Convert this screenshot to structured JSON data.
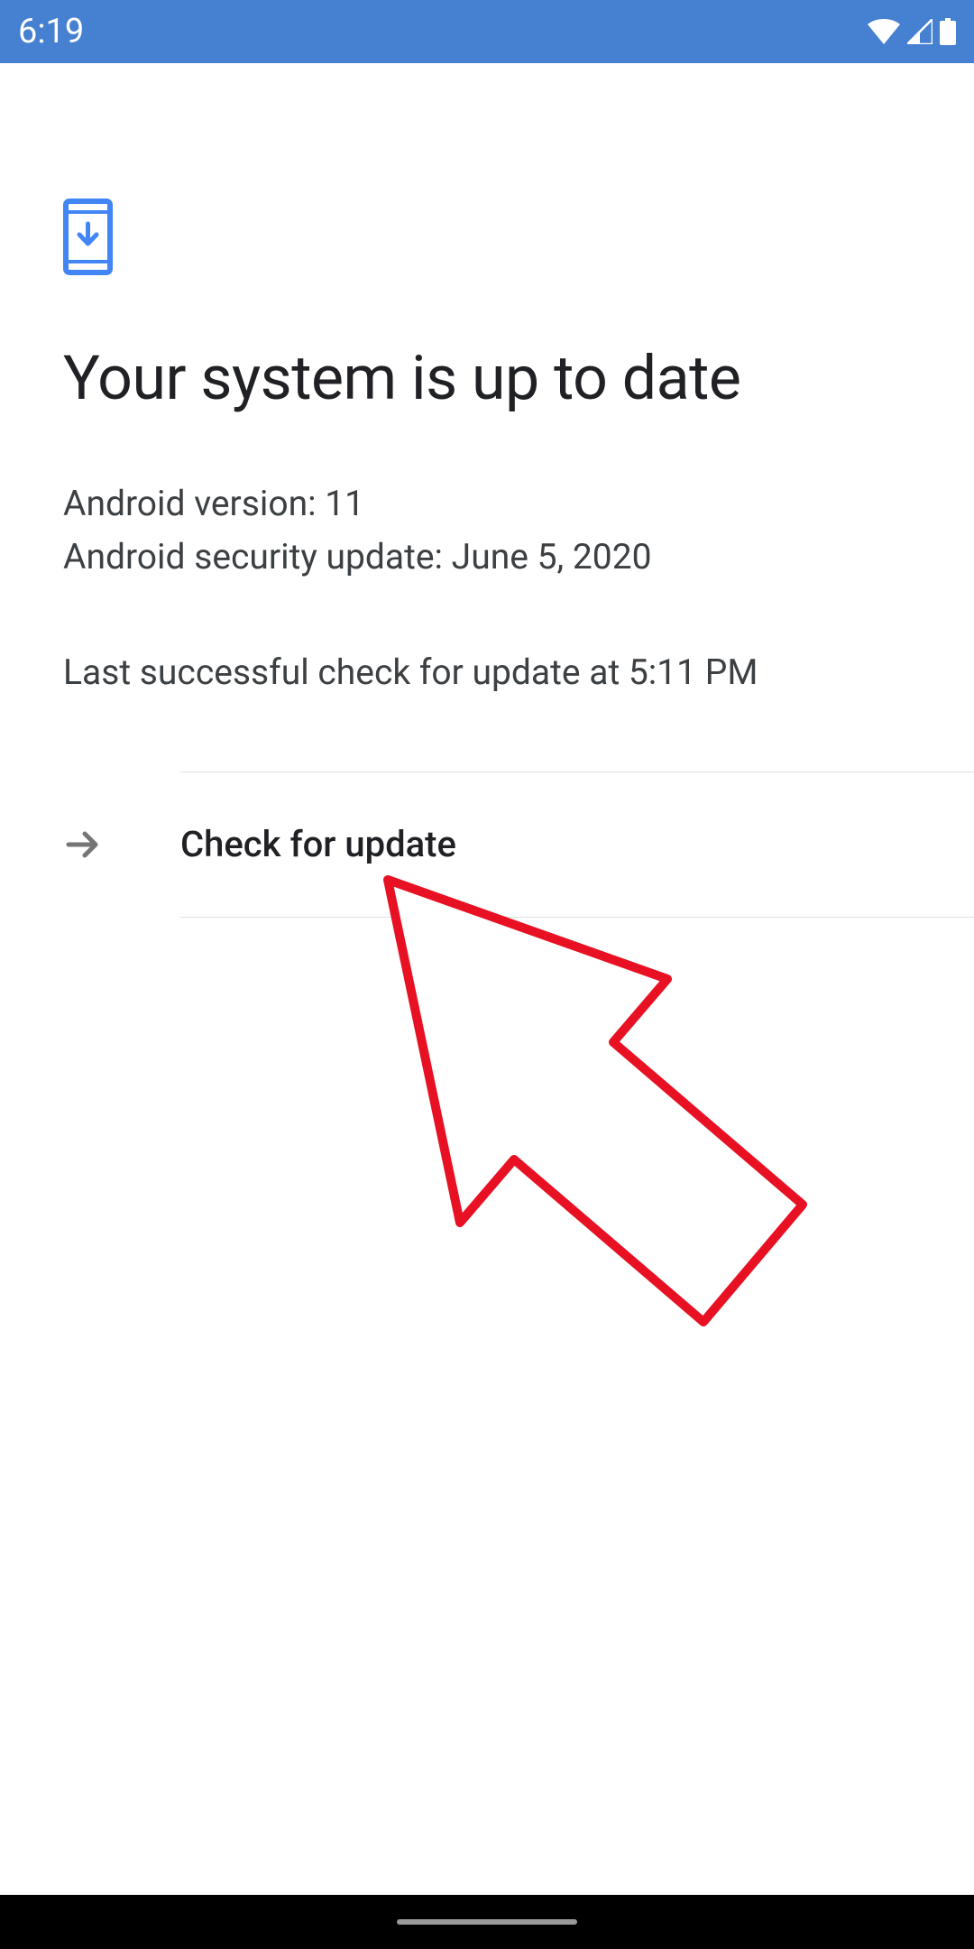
{
  "statusBar": {
    "time": "6:19"
  },
  "main": {
    "title": "Your system is up to date",
    "androidVersion": "Android version: 11",
    "securityUpdate": "Android security update: June 5, 2020",
    "lastCheck": "Last successful check for update at 5:11 PM",
    "checkUpdateLabel": "Check for update"
  }
}
